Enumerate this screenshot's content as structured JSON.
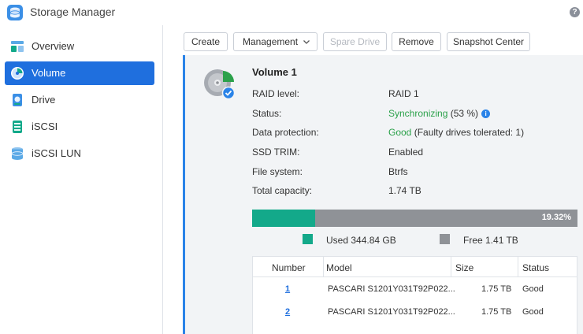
{
  "app": {
    "title": "Storage Manager",
    "help_icon": "question-icon",
    "help_glyph": "?"
  },
  "sidebar": {
    "items": [
      {
        "label": "Overview",
        "icon": "overview-icon",
        "active": false
      },
      {
        "label": "Volume",
        "icon": "volume-icon",
        "active": true
      },
      {
        "label": "Drive",
        "icon": "drive-icon",
        "active": false
      },
      {
        "label": "iSCSI",
        "icon": "iscsi-icon",
        "active": false
      },
      {
        "label": "iSCSI LUN",
        "icon": "iscsi-lun-icon",
        "active": false
      }
    ]
  },
  "toolbar": {
    "create": "Create",
    "management": "Management",
    "spare_drive": "Spare Drive",
    "remove": "Remove",
    "snapshot_center": "Snapshot Center"
  },
  "volume": {
    "title": "Volume 1",
    "props": {
      "raid_label": "RAID level:",
      "raid_value": "RAID 1",
      "status_label": "Status:",
      "status_value": "Synchronizing",
      "status_extra": " (53 %)",
      "protection_label": "Data protection:",
      "protection_value": "Good",
      "protection_extra": " (Faulty drives tolerated: 1)",
      "trim_label": "SSD TRIM:",
      "trim_value": "Enabled",
      "fs_label": "File system:",
      "fs_value": "Btrfs",
      "capacity_label": "Total capacity:",
      "capacity_value": "1.74 TB"
    },
    "usage": {
      "used_fraction": 0.1932,
      "percent_text": "19.32%"
    },
    "legend": {
      "used": "Used 344.84 GB",
      "free": "Free 1.41 TB"
    }
  },
  "drives": {
    "headers": {
      "number": "Number",
      "model": "Model",
      "size": "Size",
      "status": "Status"
    },
    "rows": [
      {
        "number": "1",
        "model": "PASCARI S1201Y031T92P022...",
        "size": "1.75 TB",
        "status": "Good"
      },
      {
        "number": "2",
        "model": "PASCARI S1201Y031T92P022...",
        "size": "1.75 TB",
        "status": "Good"
      }
    ]
  },
  "colors": {
    "accent": "#1f6fde",
    "used": "#13a98a",
    "free": "#8f9297",
    "good": "#2ba14a"
  }
}
